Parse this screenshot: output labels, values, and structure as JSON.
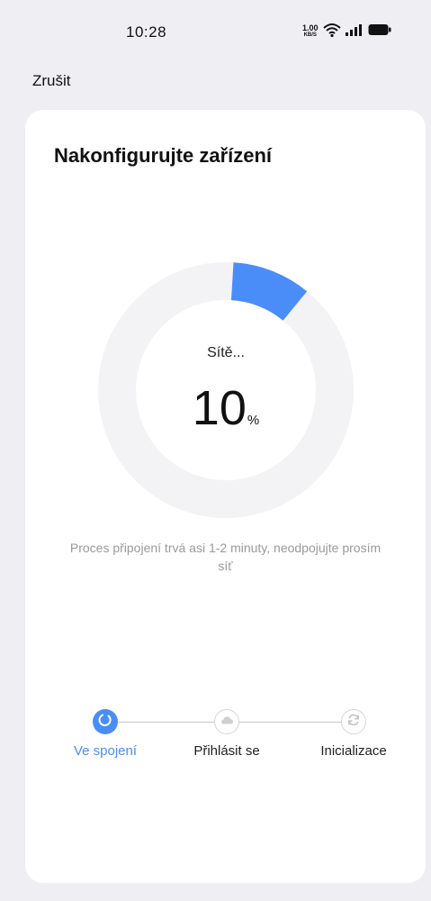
{
  "status_bar": {
    "time": "10:28",
    "net_speed_value": "1.00",
    "net_speed_unit": "KB/S",
    "icons": [
      "wifi-icon",
      "signal-icon",
      "battery-icon"
    ]
  },
  "header": {
    "cancel_label": "Zrušit"
  },
  "card": {
    "title": "Nakonfigurujte zařízení",
    "progress": {
      "step_text": "Sítě...",
      "value": "10",
      "unit": "%",
      "fraction": 0.1,
      "track_color": "#f3f3f5",
      "fill_color": "#4b8df8"
    },
    "hint": "Proces připojení trvá asi 1-2 minuty, neodpojujte prosím síť",
    "steps": [
      {
        "label": "Ve spojení",
        "icon": "loading-icon",
        "state": "active"
      },
      {
        "label": "Přihlásit se",
        "icon": "cloud-icon",
        "state": "idle"
      },
      {
        "label": "Inicializace",
        "icon": "refresh-icon",
        "state": "idle"
      }
    ]
  },
  "colors": {
    "accent": "#4b8df8",
    "background": "#efeff3",
    "card": "#ffffff"
  }
}
